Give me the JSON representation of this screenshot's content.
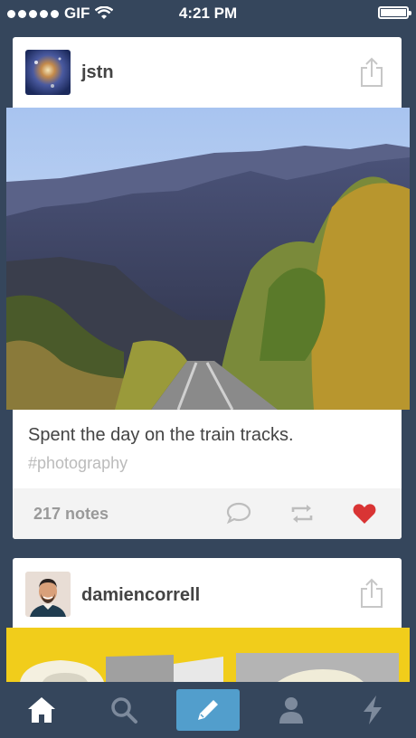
{
  "status_bar": {
    "carrier": "GIF",
    "time": "4:21 PM"
  },
  "posts": [
    {
      "username": "jstn",
      "caption": "Spent the day on the train tracks.",
      "tags": "#photography",
      "notes": "217 notes",
      "liked": true
    },
    {
      "username": "damiencorrell"
    }
  ],
  "colors": {
    "background": "#35465c",
    "compose": "#529ecc",
    "like": "#d95e40",
    "yellow": "#f1cd1b"
  },
  "tabs": [
    {
      "icon": "home-icon"
    },
    {
      "icon": "search-icon"
    },
    {
      "icon": "compose-icon"
    },
    {
      "icon": "account-icon"
    },
    {
      "icon": "activity-icon"
    }
  ]
}
